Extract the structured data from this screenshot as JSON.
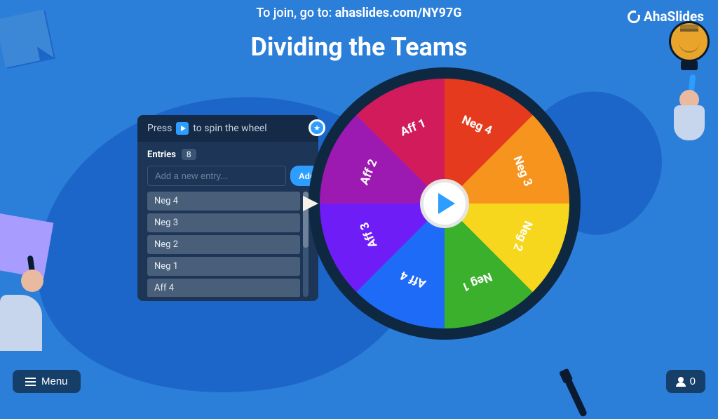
{
  "join": {
    "prefix": "To join, go to: ",
    "url": "ahaslides.com/NY97G"
  },
  "brand": "AhaSlides",
  "title": "Dividing the Teams",
  "panel": {
    "hint_before": "Press",
    "hint_after": "to spin the wheel",
    "entries_label": "Entries",
    "entries_count": "8",
    "placeholder": "Add a new entry...",
    "add_label": "Add",
    "entries": [
      "Neg 4",
      "Neg 3",
      "Neg 2",
      "Neg 1",
      "Aff 4"
    ]
  },
  "wheel": {
    "segments": [
      {
        "label": "Neg 4",
        "color": "#9c1ab1"
      },
      {
        "label": "Neg 3",
        "color": "#d11b5b"
      },
      {
        "label": "Neg 2",
        "color": "#e63a1e"
      },
      {
        "label": "Neg 1",
        "color": "#f7941d"
      },
      {
        "label": "Aff 4",
        "color": "#f7d71d"
      },
      {
        "label": "Aff 3",
        "color": "#3ab02c"
      },
      {
        "label": "Aff 2",
        "color": "#1d6bf7"
      },
      {
        "label": "Aff 1",
        "color": "#6e1df7"
      }
    ]
  },
  "menu_label": "Menu",
  "participants_count": "0"
}
